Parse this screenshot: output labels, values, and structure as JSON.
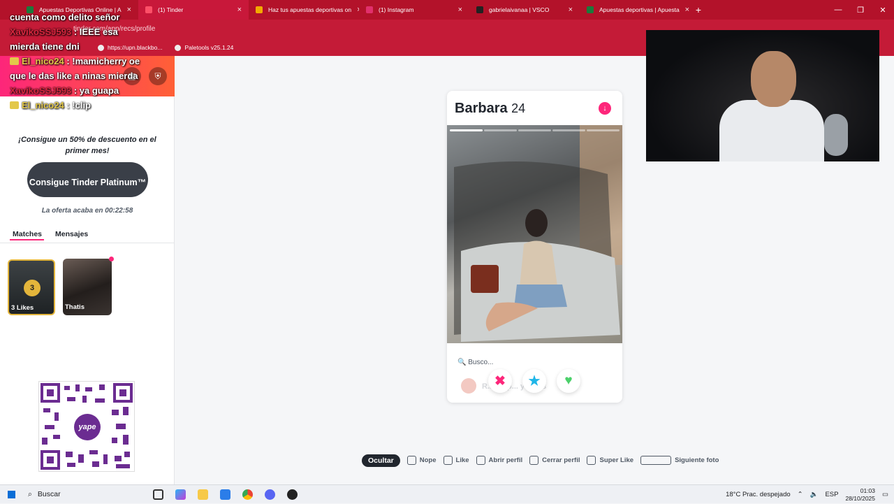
{
  "browser": {
    "tabs": [
      {
        "title": "Apuestas Deportivas Online | A",
        "color": "#1c7a3c"
      },
      {
        "title": "(1) Tinder",
        "color": "#fd5068",
        "active": true
      },
      {
        "title": "Haz tus apuestas deportivas on",
        "color": "#f2a900"
      },
      {
        "title": "(1) Instagram",
        "color": "#e1306c"
      },
      {
        "title": "gabrielaivanaa | VSCO",
        "color": "#222222"
      },
      {
        "title": "Apuestas deportivas | Apuesta",
        "color": "#1c7a3c"
      }
    ],
    "url": "tinder.com/app/recs/profile",
    "bookmarks": [
      {
        "label": "https://upn.blackbo..."
      },
      {
        "label": "Paletools v25.1.24"
      }
    ]
  },
  "chat": [
    {
      "user": "",
      "text": "cuenta como delito señor"
    },
    {
      "user": "XavikoSSJ593",
      "user_color": "red",
      "text": ": IEEE esa mierda tiene dni"
    },
    {
      "user": "El_nico24",
      "user_color": "gold",
      "text": ": !mamicherry oe que le das like a ninas mierda"
    },
    {
      "user": "XavikoSSJ593",
      "user_color": "red",
      "text": ": ya guapa"
    },
    {
      "user": "El_nico24",
      "user_color": "gold",
      "text": ": !clip"
    }
  ],
  "sidebar": {
    "promo_text": "¡Consigue un 50% de descuento en el primer mes!",
    "platinum_button": "Consigue Tinder Platinum™",
    "offer_text": "La oferta acaba en 00:22:58",
    "tabs": [
      {
        "label": "Matches"
      },
      {
        "label": "Mensajes"
      }
    ],
    "likes": {
      "count": "3",
      "label": "3 Likes"
    },
    "match": {
      "name": "Thatis"
    },
    "qr_logo": "yape"
  },
  "profile": {
    "name": "Barbara",
    "age": "24",
    "photo_count": 5,
    "photo_active": 1,
    "looking_for": "Busco...",
    "reaction_text": "R... en p... ya ...os"
  },
  "actions": {
    "nope": "✖",
    "superlike": "★",
    "like": "♥"
  },
  "shortcuts": {
    "hide": "Ocultar",
    "items": [
      {
        "label": "Nope"
      },
      {
        "label": "Like"
      },
      {
        "label": "Abrir perfil"
      },
      {
        "label": "Cerrar perfil"
      },
      {
        "label": "Super Like"
      },
      {
        "label": "Siguiente foto"
      }
    ]
  },
  "taskbar": {
    "search_placeholder": "Buscar",
    "weather": "18°C  Prac. despejado",
    "lang": "ESP",
    "time": "01:03",
    "date": "28/10/2025"
  },
  "colors": {
    "brand": "#fd267a",
    "browser": "#c41b37",
    "gold": "#e3b53b"
  }
}
